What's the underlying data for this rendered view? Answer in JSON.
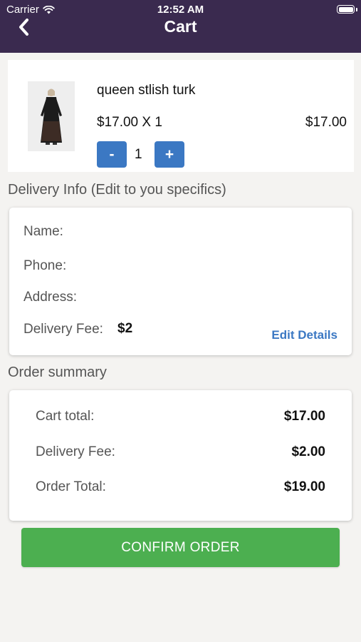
{
  "status_bar": {
    "carrier": "Carrier",
    "time": "12:52 AM"
  },
  "header": {
    "title": "Cart"
  },
  "cart_items": [
    {
      "name": "queen stlish turk",
      "price_qty": "$17.00 X 1",
      "line_total": "$17.00",
      "quantity": "1",
      "decrement_label": "-",
      "increment_label": "+"
    }
  ],
  "delivery": {
    "section_title": "Delivery Info (Edit to you specifics)",
    "name_label": "Name:",
    "phone_label": "Phone:",
    "address_label": "Address:",
    "fee_label": "Delivery Fee:",
    "fee_value": "$2",
    "edit_label": "Edit Details"
  },
  "summary": {
    "section_title": "Order summary",
    "cart_total_label": "Cart total:",
    "cart_total_value": "$17.00",
    "delivery_fee_label": "Delivery Fee:",
    "delivery_fee_value": "$2.00",
    "order_total_label": "Order Total:",
    "order_total_value": "$19.00"
  },
  "confirm_label": "CONFIRM ORDER",
  "colors": {
    "header_bg": "#3a2a4f",
    "accent_blue": "#3b78c3",
    "confirm_green": "#4caf50",
    "page_bg": "#f4f3f1"
  },
  "icons": {
    "wifi": "wifi-icon",
    "battery": "battery-icon",
    "back": "chevron-left-icon",
    "product_image": "dress-product-image"
  }
}
